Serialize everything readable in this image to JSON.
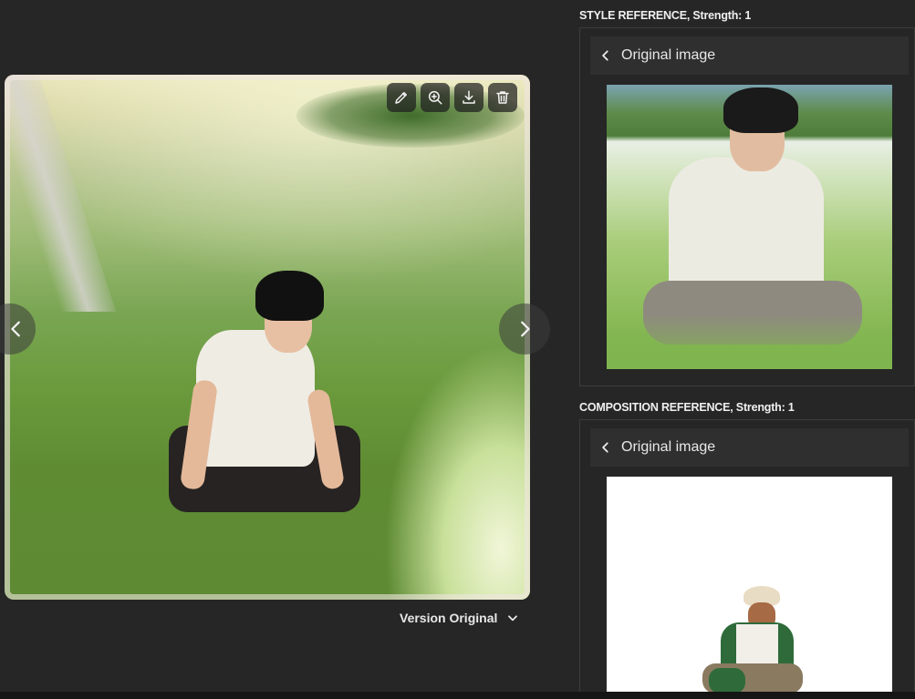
{
  "viewer": {
    "tools": [
      {
        "name": "edit-button",
        "icon": "pencil-icon"
      },
      {
        "name": "zoom-button",
        "icon": "zoom-in-icon"
      },
      {
        "name": "download-button",
        "icon": "download-icon"
      },
      {
        "name": "delete-button",
        "icon": "trash-icon"
      }
    ],
    "prev_icon": "chevron-left-icon",
    "next_icon": "chevron-right-icon",
    "version_label": "Version Original"
  },
  "style_reference": {
    "title": "STYLE REFERENCE, Strength: 1",
    "header_label": "Original image"
  },
  "composition_reference": {
    "title": "COMPOSITION REFERENCE, Strength: 1",
    "header_label": "Original image"
  },
  "colors": {
    "background": "#262626",
    "panel_header": "#2f2f2f",
    "text": "#e8e8e8"
  }
}
